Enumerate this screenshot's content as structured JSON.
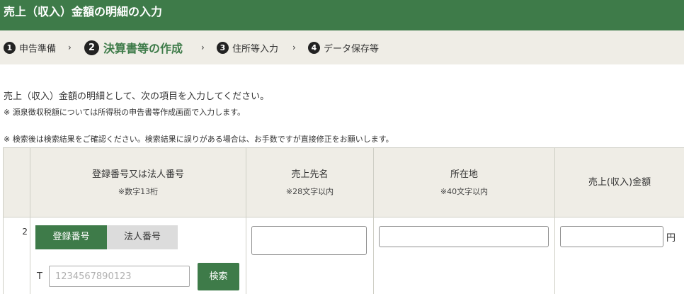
{
  "header": {
    "title": "売上（収入）金額の明細の入力"
  },
  "steps": [
    {
      "num": "1",
      "label": "申告準備"
    },
    {
      "num": "2",
      "label": "決算書等の作成"
    },
    {
      "num": "3",
      "label": "住所等入力"
    },
    {
      "num": "4",
      "label": "データ保存等"
    }
  ],
  "step_separator": "›",
  "current_step": 2,
  "intro": {
    "main": "売上（収入）金額の明細として、次の項目を入力してください。",
    "note1": "※ 源泉徴収税額については所得税の申告書等作成画面で入力します。",
    "note2": "※ 検索後は検索結果をご確認ください。検索結果に誤りがある場合は、お手数ですが直接修正をお願いします。"
  },
  "table": {
    "columns": [
      {
        "label": "登録番号又は法人番号",
        "sub": "※数字13桁"
      },
      {
        "label": "売上先名",
        "sub": "※28文字以内"
      },
      {
        "label": "所在地",
        "sub": "※40文字以内"
      },
      {
        "label": "売上(収入)金額",
        "sub": ""
      }
    ],
    "row": {
      "number": "2",
      "toggle": {
        "option1": "登録番号",
        "option2": "法人番号",
        "selected": "登録番号"
      },
      "t_prefix": "T",
      "reg_placeholder": "1234567890123",
      "reg_value": "",
      "search_label": "検索",
      "customer_name": "",
      "address": "",
      "amount": "",
      "yen_unit": "円"
    }
  },
  "colors": {
    "header_green": "#3e7b49",
    "step_bar_bg": "#efede6",
    "table_header_bg": "#efede6",
    "toggle_inactive": "#dcdcdc"
  }
}
